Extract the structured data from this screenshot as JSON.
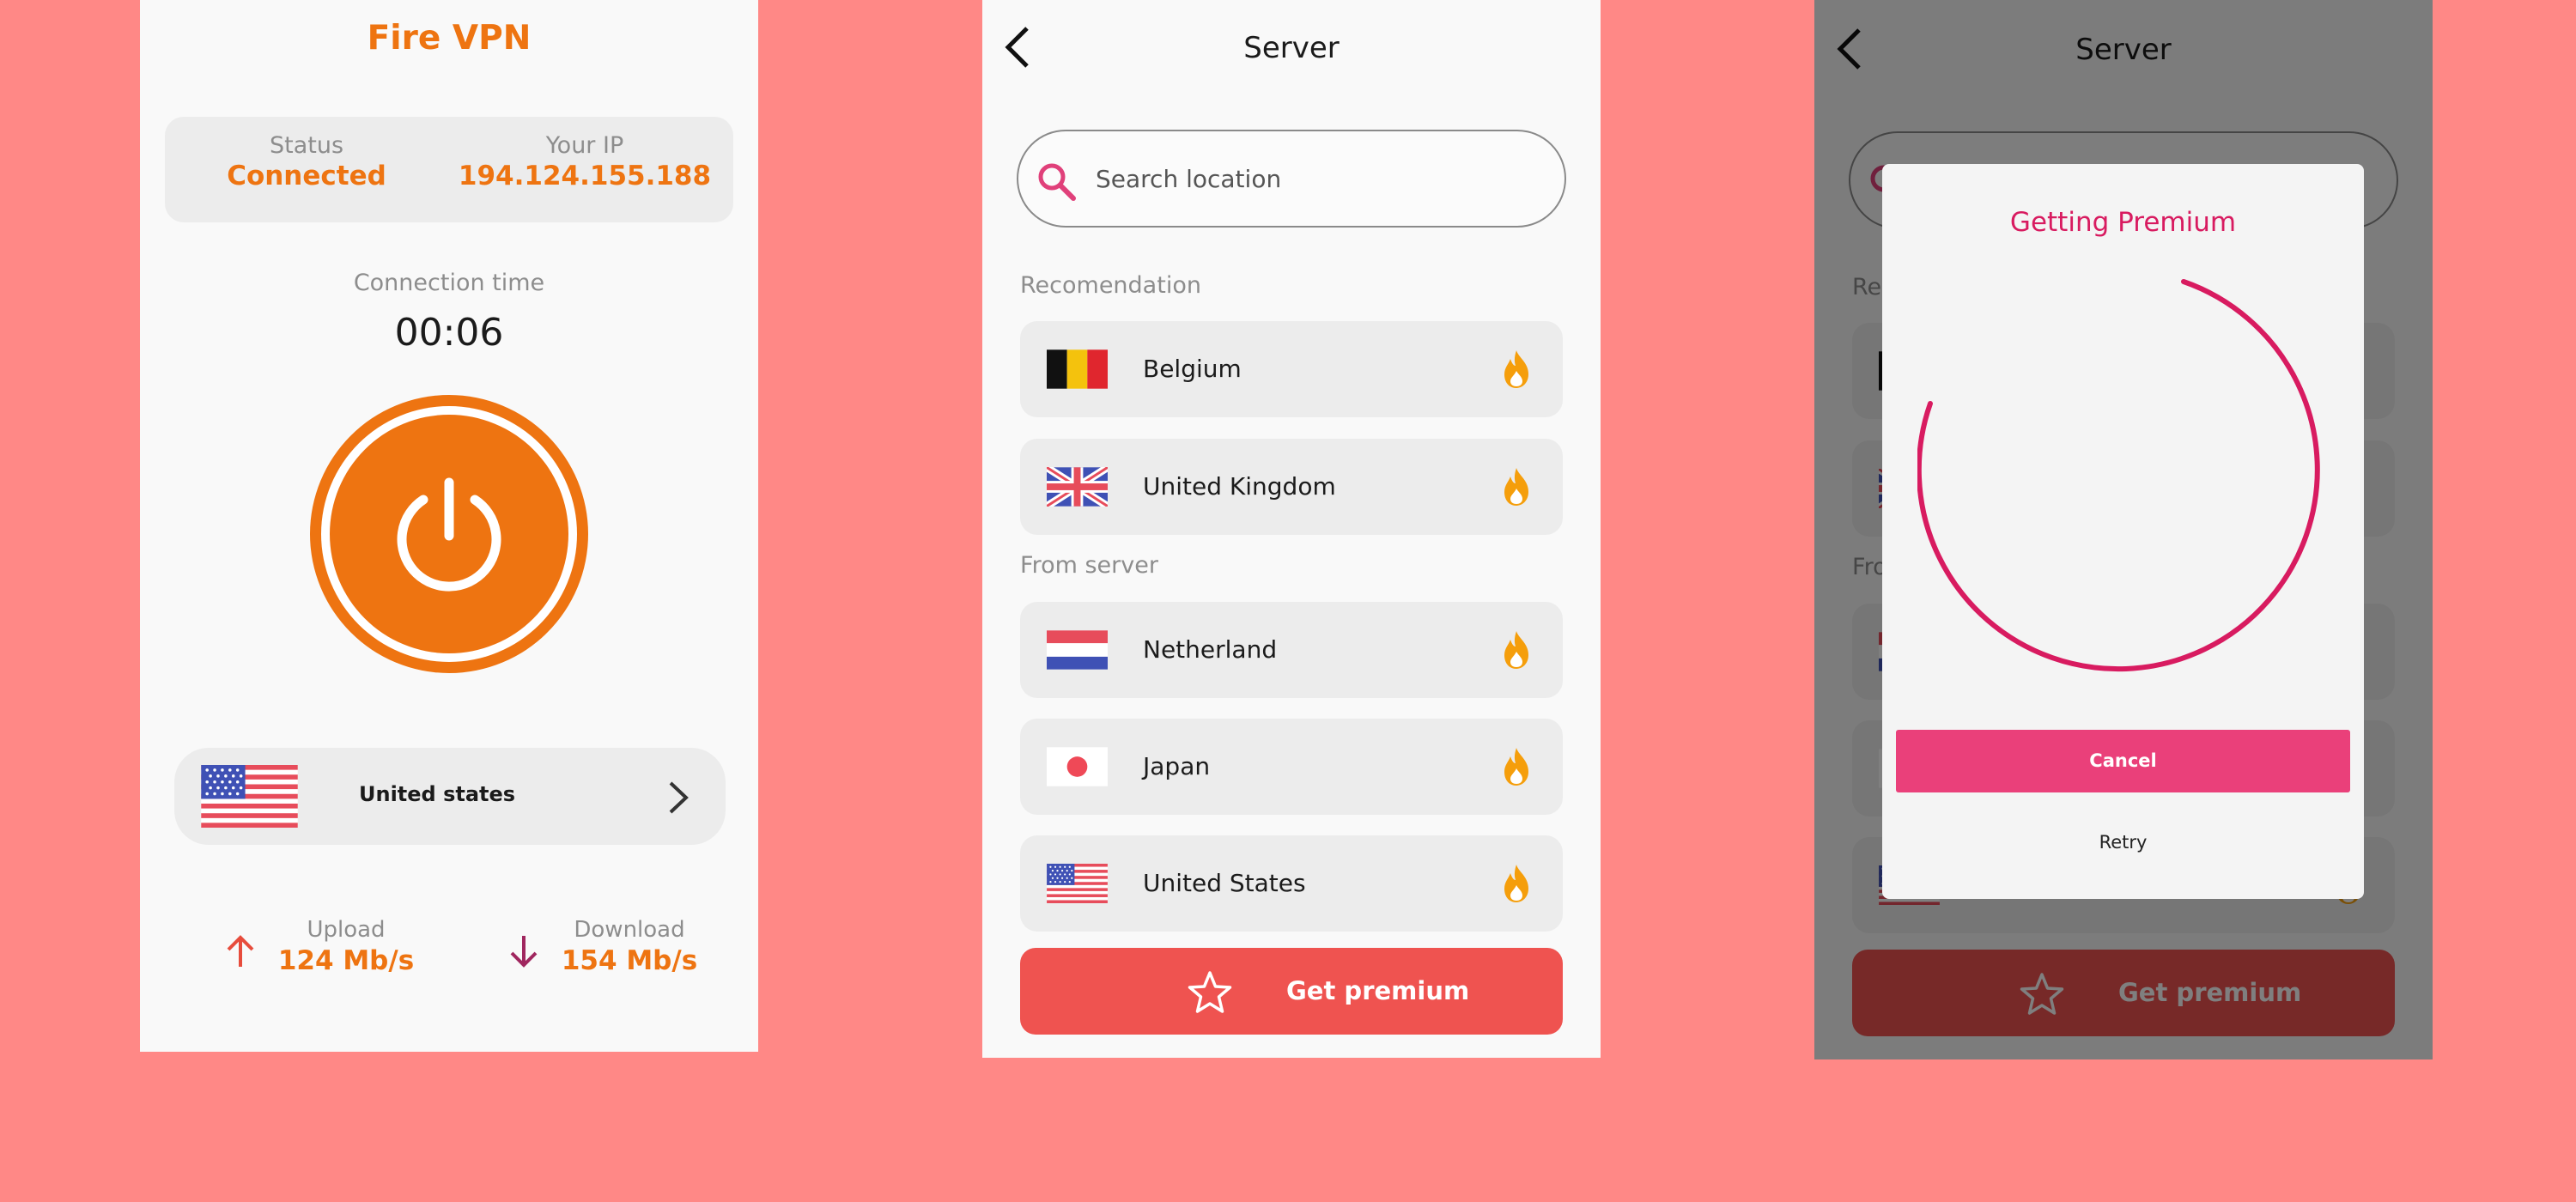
{
  "colors": {
    "background": "#ff8886",
    "brand_orange": "#ee7411",
    "accent_pink": "#d81b60",
    "premium_red": "#ef5350",
    "fire_icon": "#f59e0b"
  },
  "home": {
    "app_title": "Fire VPN",
    "status_label": "Status",
    "status_value": "Connected",
    "ip_label": "Your IP",
    "ip_value": "194.124.155.188",
    "connection_time_label": "Connection time",
    "connection_time": "00:06",
    "power_icon": "power-icon",
    "selected_country": "United states",
    "upload_label": "Upload",
    "upload_value": "124 Mb/s",
    "download_label": "Download",
    "download_value": "154 Mb/s"
  },
  "server": {
    "title": "Server",
    "search_placeholder": "Search location",
    "recommendation_label": "Recomendation",
    "from_server_label": "From server",
    "recommended": [
      {
        "name": "Belgium",
        "flag": "belgium-flag-icon"
      },
      {
        "name": "United Kingdom",
        "flag": "uk-flag-icon"
      }
    ],
    "servers": [
      {
        "name": "Netherland",
        "flag": "netherlands-flag-icon"
      },
      {
        "name": "Japan",
        "flag": "japan-flag-icon"
      },
      {
        "name": "United States",
        "flag": "us-flag-icon"
      }
    ],
    "premium_label": "Get premium"
  },
  "dialog": {
    "title": "Getting Premium",
    "cancel_label": "Cancel",
    "retry_label": "Retry"
  }
}
